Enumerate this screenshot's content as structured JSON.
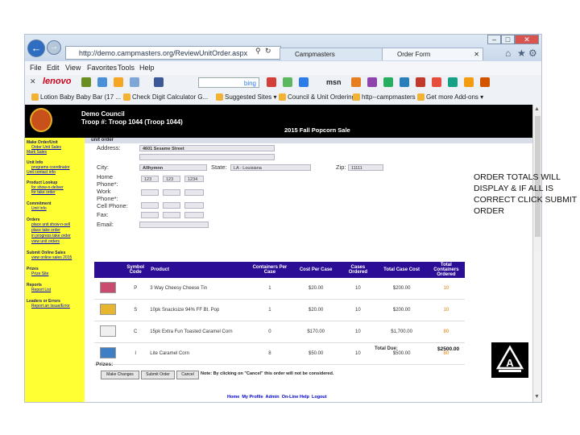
{
  "browser": {
    "url": "http://demo.campmasters.org/ReviewUnitOrder.aspx",
    "tabs": [
      {
        "label": "Campmasters"
      },
      {
        "label": "Order Form"
      }
    ],
    "window_buttons": [
      "–",
      "□",
      "✕"
    ],
    "menu": [
      "File",
      "Edit",
      "View",
      "Favorites",
      "Tools",
      "Help"
    ],
    "search_placeholder": "bing",
    "toolbar_brand": "lenovo",
    "toolbar_msn": "msn",
    "favorites": [
      "Lotion Baby Baby Bar (17 ...",
      "Check Digit Calculator G...",
      "Suggested Sites",
      "Council & Unit Ordering",
      "http--campmasters",
      "Get more Add-ons"
    ]
  },
  "page": {
    "council": "Demo Council",
    "troop": "Troop #: Troop 1044 (Troop 1044)",
    "sale_title": "2015 Fall Popcorn Sale",
    "section": "unit order"
  },
  "sidebar": {
    "groups": [
      {
        "heading": "Make Order/Unit",
        "links": [
          "Order Unit Sales",
          "Mark Sales"
        ]
      },
      {
        "heading": "Unit Info",
        "links": [
          "programs coordinator",
          "Unit contact info"
        ]
      },
      {
        "heading": "Product Lookup",
        "links": [
          "for show-n-deliver",
          "for take order"
        ]
      },
      {
        "heading": "Commitment",
        "links": [
          "Unit Info"
        ]
      },
      {
        "heading": "Orders",
        "links": [
          "place unit show-n-sell",
          "place take order",
          "in progress take order",
          "view unit orders"
        ]
      },
      {
        "heading": "Submit Online Sales",
        "links": [
          "view online sales 2015"
        ]
      },
      {
        "heading": "Prizes",
        "links": [
          "Prize Site"
        ]
      },
      {
        "heading": "Reports",
        "links": [
          "Report List"
        ]
      },
      {
        "heading": "Leaders or Errors",
        "links": [
          "Report an Issue/Error"
        ]
      }
    ]
  },
  "form": {
    "address_label": "Address:",
    "address": "4601 Sesame Street",
    "address2": "",
    "city_label": "City:",
    "city": "Allhymnn",
    "state_label": "State:",
    "state": "LA - Louisiana",
    "zip_label": "Zip:",
    "zip": "11111",
    "home_label": "Home Phone*:",
    "home_phone": [
      "123",
      "123",
      "1234"
    ],
    "work_label": "Work Phone*:",
    "cell_label": "Cell Phone:",
    "fax_label": "Fax:",
    "email_label": "Email:"
  },
  "products": {
    "headers": [
      "Symbol Code",
      "Product",
      "Containers Per Case",
      "Cost Per Case",
      "Cases Ordered",
      "Total Case Cost",
      "Total Containers Ordered"
    ],
    "rows": [
      {
        "code": "P",
        "name": "3 Way Cheesy Cheese Tin",
        "per_case": "1",
        "cost": "$20.00",
        "cases": "10",
        "total": "$200.00",
        "containers": "10"
      },
      {
        "code": "S",
        "name": "10pk Snacksize 94% FF Bt. Pop",
        "per_case": "1",
        "cost": "$20.00",
        "cases": "10",
        "total": "$200.00",
        "containers": "10"
      },
      {
        "code": "C",
        "name": "15pk Extra Fun Toasted Caramel Corn",
        "per_case": "0",
        "cost": "$170.00",
        "cases": "10",
        "total": "$1,700.00",
        "containers": "80"
      },
      {
        "code": "I",
        "name": "Lite Caramel Corn",
        "per_case": "8",
        "cost": "$50.00",
        "cases": "10",
        "total": "$500.00",
        "containers": "80"
      }
    ],
    "total_due_label": "Total Due:",
    "total_due": "$2500.00"
  },
  "prizes_label": "Prizes:",
  "buttons": {
    "make_changes": "Make Changes",
    "submit": "Submit Order",
    "cancel": "Cancel"
  },
  "cancel_note": "Note: By clicking on \"Cancel\" this order will not be considered.",
  "footer_links": [
    "Home",
    "My Profile",
    "Admin",
    "On-Line Help",
    "Logout"
  ],
  "annotation": "ORDER TOTALS WILL DISPLAY & IF ALL IS CORRECT CLICK SUBMIT ORDER",
  "colors": {
    "sidebar": "#ffff33",
    "table_header": "#2b0d96",
    "header_bg": "#000000",
    "link": "#0000cc"
  }
}
